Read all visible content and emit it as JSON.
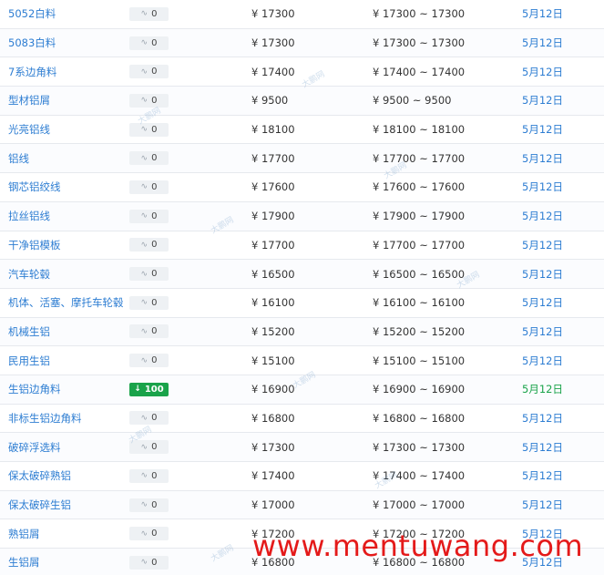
{
  "table": {
    "rows": [
      {
        "name": "5052白料",
        "change": "0",
        "price": "¥ 17300",
        "range": "¥ 17300 ~ 17300",
        "date": "5月12日"
      },
      {
        "name": "5083白料",
        "change": "0",
        "price": "¥ 17300",
        "range": "¥ 17300 ~ 17300",
        "date": "5月12日"
      },
      {
        "name": "7系边角料",
        "change": "0",
        "price": "¥ 17400",
        "range": "¥ 17400 ~ 17400",
        "date": "5月12日"
      },
      {
        "name": "型材铝屑",
        "change": "0",
        "price": "¥ 9500",
        "range": "¥ 9500 ~ 9500",
        "date": "5月12日"
      },
      {
        "name": "光亮铝线",
        "change": "0",
        "price": "¥ 18100",
        "range": "¥ 18100 ~ 18100",
        "date": "5月12日"
      },
      {
        "name": "铝线",
        "change": "0",
        "price": "¥ 17700",
        "range": "¥ 17700 ~ 17700",
        "date": "5月12日"
      },
      {
        "name": "钢芯铝绞线",
        "change": "0",
        "price": "¥ 17600",
        "range": "¥ 17600 ~ 17600",
        "date": "5月12日"
      },
      {
        "name": "拉丝铝线",
        "change": "0",
        "price": "¥ 17900",
        "range": "¥ 17900 ~ 17900",
        "date": "5月12日"
      },
      {
        "name": "干净铝模板",
        "change": "0",
        "price": "¥ 17700",
        "range": "¥ 17700 ~ 17700",
        "date": "5月12日"
      },
      {
        "name": "汽车轮毂",
        "change": "0",
        "price": "¥ 16500",
        "range": "¥ 16500 ~ 16500",
        "date": "5月12日"
      },
      {
        "name": "机体、活塞、摩托车轮毂",
        "change": "0",
        "price": "¥ 16100",
        "range": "¥ 16100 ~ 16100",
        "date": "5月12日"
      },
      {
        "name": "机械生铝",
        "change": "0",
        "price": "¥ 15200",
        "range": "¥ 15200 ~ 15200",
        "date": "5月12日"
      },
      {
        "name": "民用生铝",
        "change": "0",
        "price": "¥ 15100",
        "range": "¥ 15100 ~ 15100",
        "date": "5月12日"
      },
      {
        "name": "生铝边角料",
        "change": "100",
        "price": "¥ 16900",
        "range": "¥ 16900 ~ 16900",
        "date": "5月12日"
      },
      {
        "name": "非标生铝边角料",
        "change": "0",
        "price": "¥ 16800",
        "range": "¥ 16800 ~ 16800",
        "date": "5月12日"
      },
      {
        "name": "破碎浮选料",
        "change": "0",
        "price": "¥ 17300",
        "range": "¥ 17300 ~ 17300",
        "date": "5月12日"
      },
      {
        "name": "保太破碎熟铝",
        "change": "0",
        "price": "¥ 17400",
        "range": "¥ 17400 ~ 17400",
        "date": "5月12日"
      },
      {
        "name": "保太破碎生铝",
        "change": "0",
        "price": "¥ 17000",
        "range": "¥ 17000 ~ 17000",
        "date": "5月12日"
      },
      {
        "name": "熟铝屑",
        "change": "0",
        "price": "¥ 17200",
        "range": "¥ 17200 ~ 17200",
        "date": "5月12日"
      },
      {
        "name": "生铝屑",
        "change": "0",
        "price": "¥ 16800",
        "range": "¥ 16800 ~ 16800",
        "date": "5月12日"
      }
    ]
  },
  "watermark": {
    "faint_text": "大鹏网",
    "site_text": "www.mentuwang.com"
  },
  "colors": {
    "link": "#2d7dd2",
    "down_badge": "#1aa34a",
    "neutral_badge": "#eef1f4",
    "site_watermark": "#e41a1a"
  },
  "icons": {
    "flat_change": "flat-change-icon",
    "down_change": "down-arrow-icon"
  }
}
